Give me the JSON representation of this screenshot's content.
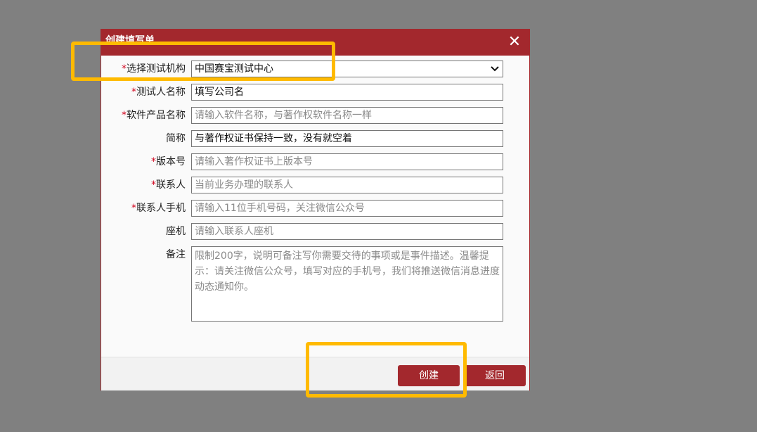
{
  "dialog": {
    "title": "创建填写单",
    "close_label": "✕"
  },
  "form": {
    "institution": {
      "label": "选择测试机构",
      "required": "*",
      "value": "中国赛宝测试中心"
    },
    "tester_name": {
      "label": "测试人名称",
      "required": "*",
      "value": "填写公司名"
    },
    "product_name": {
      "label": "软件产品名称",
      "required": "*",
      "placeholder": "请输入软件名称，与著作权软件名称一样"
    },
    "short_name": {
      "label": "简称",
      "value": "与著作权证书保持一致，没有就空着"
    },
    "version": {
      "label": "版本号",
      "required": "*",
      "placeholder": "请输入著作权证书上版本号"
    },
    "contact": {
      "label": "联系人",
      "required": "*",
      "placeholder": "当前业务办理的联系人"
    },
    "contact_phone": {
      "label": "联系人手机",
      "required": "*",
      "placeholder": "请输入11位手机号码，关注微信公众号"
    },
    "landline": {
      "label": "座机",
      "placeholder": "请输入联系人座机"
    },
    "remarks": {
      "label": "备注",
      "placeholder": "限制200字，说明可备注写你需要交待的事项或是事件描述。温馨提示：请关注微信公众号，填写对应的手机号，我们将推送微信消息进度动态通知你。"
    }
  },
  "footer": {
    "create_label": "创建",
    "back_label": "返回"
  },
  "colors": {
    "accent": "#a3282d",
    "highlight": "#ffba00",
    "overlay": "#808080"
  }
}
